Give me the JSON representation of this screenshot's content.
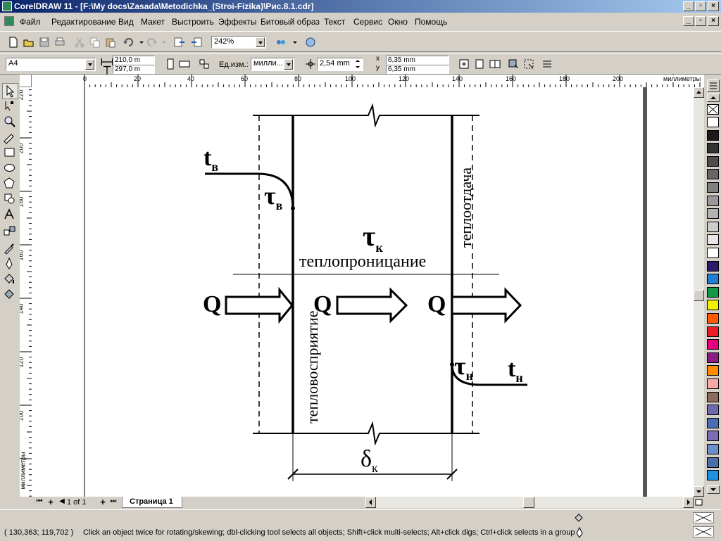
{
  "window": {
    "title": "CorelDRAW 11 - [F:\\My docs\\Zasada\\Metodichka_(Stroi-Fizika)\\Рис.8.1.cdr]"
  },
  "menu": [
    "Файл",
    "Редактирование",
    "Вид",
    "Макет",
    "Выстроить",
    "Эффекты",
    "Битовый образ",
    "Текст",
    "Сервис",
    "Окно",
    "Помощь"
  ],
  "standard_toolbar": {
    "zoom": "242%"
  },
  "property_bar": {
    "paper": "A4",
    "width": "210,0 m",
    "height": "297,0 m",
    "units_label": "Ед.изм.:",
    "units": "милли...",
    "nudge": "2,54 mm",
    "dup_x": "6,35 mm",
    "dup_y": "6,35 mm",
    "x_label": "x",
    "y_label": "y"
  },
  "rulers": {
    "unit": "миллиметры",
    "h_ticks": [
      "0",
      "20",
      "40",
      "60",
      "80",
      "100",
      "120",
      "140",
      "160",
      "180",
      "200"
    ],
    "v_ticks": [
      "220",
      "200",
      "180",
      "160",
      "140",
      "120",
      "100"
    ]
  },
  "drawing": {
    "t_inside": "t",
    "t_inside_sub": "в",
    "tau_inside": "τ",
    "tau_inside_sub": "в",
    "tau_k": "τ",
    "tau_k_sub": "к",
    "heat_penetration": "теплопроницание",
    "heat_absorption": "тепловосприятие",
    "heat_release": "теплоотдача",
    "q1": "Q",
    "q2": "Q",
    "q3": "Q",
    "tau_outside": "τ",
    "tau_outside_sub": "н",
    "t_outside": "t",
    "t_outside_sub": "н",
    "delta": "δ",
    "delta_sub": "к"
  },
  "page_nav": {
    "counter": "1 of 1",
    "tab": "Страница 1"
  },
  "status": {
    "coords": "( 130,363; 119,702 )",
    "hint": "Click an object twice for rotating/skewing; dbl-clicking tool selects all objects; Shift+click multi-selects; Alt+click digs; Ctrl+click selects in a group"
  },
  "palette_colors": [
    "#ffffff",
    "#1a1a1a",
    "#333333",
    "#4d4d4d",
    "#666666",
    "#808080",
    "#999999",
    "#b3b3b3",
    "#cccccc",
    "#e6e6e6",
    "#ffffff",
    "#2e1a6b",
    "#1f7fd0",
    "#129948",
    "#f0f000",
    "#ff5a00",
    "#ec1c24",
    "#e6007e",
    "#8c1d82",
    "#ff8c00",
    "#f7a8a8",
    "#8b6b5b",
    "#6e6aaf",
    "#4b6db4",
    "#7a6bb4",
    "#6b8fc8",
    "#4a6dac",
    "#1e90e0"
  ]
}
